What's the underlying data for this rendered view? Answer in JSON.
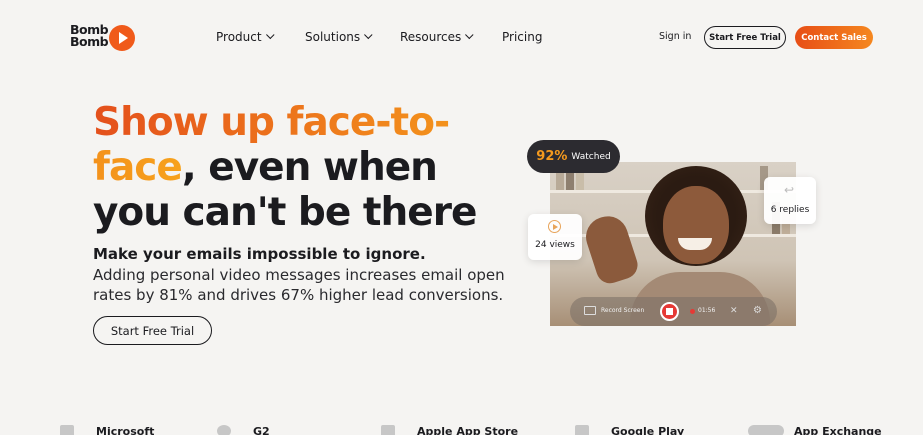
{
  "header": {
    "logo_text": "Bomb Bomb",
    "nav": [
      {
        "label": "Product",
        "has_menu": true
      },
      {
        "label": "Solutions",
        "has_menu": true
      },
      {
        "label": "Resources",
        "has_menu": true
      },
      {
        "label": "Pricing",
        "has_menu": false
      }
    ],
    "signin_label": "Sign in",
    "trial_label": "Start Free Trial",
    "sales_label": "Contact Sales"
  },
  "hero": {
    "title_accent": "Show up face-to-face",
    "title_comma": ",",
    "title_rest": "even when you can't be there",
    "subtitle": "Make your emails impossible to ignore.",
    "description": "Adding personal video messages increases email open rates by 81% and drives 67% higher lead conversions.",
    "cta_label": "Start Free Trial"
  },
  "video_card": {
    "watched_percent": "92%",
    "watched_label": "Watched",
    "views_label": "24 views",
    "replies_label": "6 replies",
    "record_screen_label": "Record Screen",
    "timer": "01:56"
  },
  "integrations": [
    {
      "label": "Microsoft"
    },
    {
      "label": "G2"
    },
    {
      "label": "Apple App Store"
    },
    {
      "label": "Google Play"
    },
    {
      "label": "App Exchange"
    }
  ],
  "colors": {
    "accent_orange": "#f05a1a",
    "accent_gradient_end": "#f7a21c",
    "dark": "#1b1b1f",
    "background": "#f5f4f2"
  }
}
